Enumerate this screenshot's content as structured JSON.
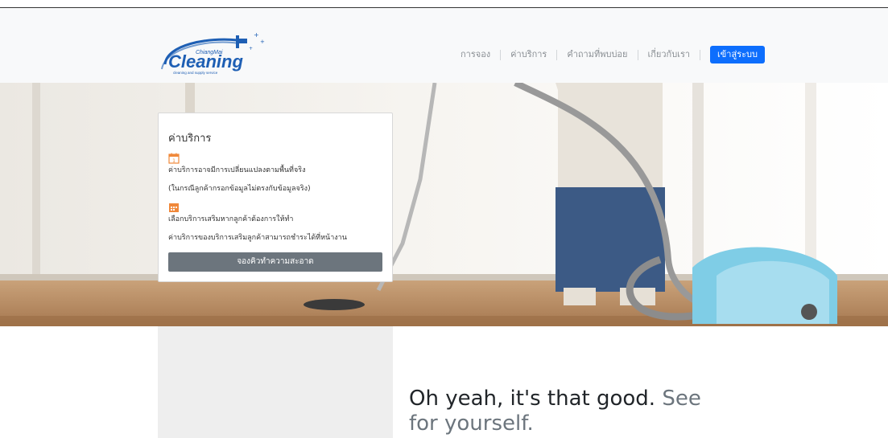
{
  "brand": {
    "logo_small": "ChiangMai",
    "logo_main": "Cleaning",
    "logo_sub": "cleaning and supply service"
  },
  "nav": {
    "items": [
      {
        "label": "การจอง"
      },
      {
        "label": "ค่าบริการ"
      },
      {
        "label": "คำถามที่พบบ่อย"
      },
      {
        "label": "เกี่ยวกับเรา"
      }
    ],
    "login_label": "เข้าสู่ระบบ"
  },
  "card": {
    "title": "ค่าบริการ",
    "line1": "ค่าบริการอาจมีการเปลี่ยนแปลงตามพื้นที่จริง",
    "line2": "(ในกรณีลูกค้ากรอกข้อมูลไม่ตรงกับข้อมูลจริง)",
    "line3": "เลือกบริการเสริมหากลูกค้าต้องการให้ทำ",
    "line4": "ค่าบริการของบริการเสริมลูกค้าสามารถชำระได้ที่หน้างาน",
    "button_label": "จองคิวทำความสะอาด",
    "calendar_day": "1"
  },
  "tagline": {
    "strong": "Oh yeah, it's that good.",
    "muted": "See for yourself."
  },
  "colors": {
    "primary": "#0d6efd",
    "button_gray": "#6c757d",
    "icon_orange": "#f0883a",
    "logo_blue": "#1e5fb4"
  }
}
